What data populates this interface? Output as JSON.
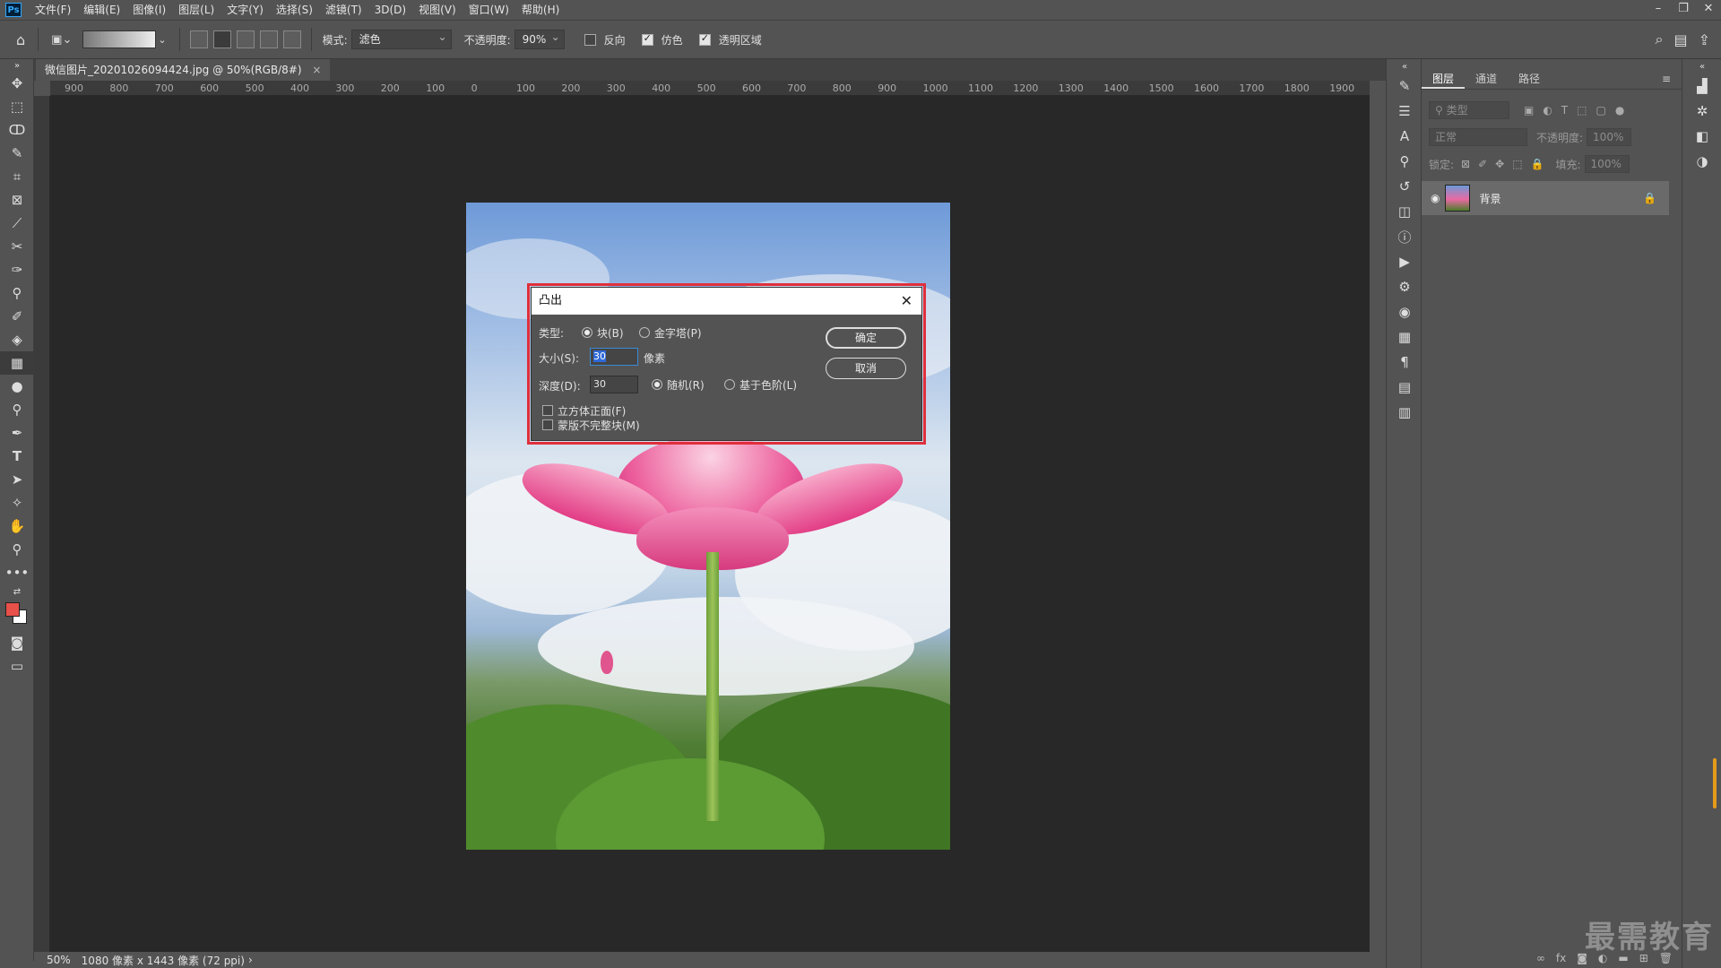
{
  "menubar": {
    "logo": "Ps",
    "items": [
      "文件(F)",
      "编辑(E)",
      "图像(I)",
      "图层(L)",
      "文字(Y)",
      "选择(S)",
      "滤镜(T)",
      "3D(D)",
      "视图(V)",
      "窗口(W)",
      "帮助(H)"
    ]
  },
  "options": {
    "mode_label": "模式:",
    "mode_value": "滤色",
    "opacity_label": "不透明度:",
    "opacity_value": "90%",
    "reverse_label": "反向",
    "dither_label": "仿色",
    "transparency_label": "透明区域"
  },
  "document": {
    "tab_title": "微信图片_20201026094424.jpg @ 50%(RGB/8#)",
    "tab_close": "×"
  },
  "ruler": {
    "top_ticks": [
      "900",
      "800",
      "700",
      "600",
      "500",
      "400",
      "300",
      "200",
      "100",
      "0",
      "100",
      "200",
      "300",
      "400",
      "500",
      "600",
      "700",
      "800",
      "900",
      "1000",
      "1100",
      "1200",
      "1300",
      "1400",
      "1500",
      "1600",
      "1700",
      "1800",
      "1900"
    ]
  },
  "status": {
    "zoom": "50%",
    "info": "1080 像素 x 1443 像素 (72 ppi)",
    "arrow": "›"
  },
  "dialog": {
    "title": "凸出",
    "close": "✕",
    "type_label": "类型:",
    "type_block": "块(B)",
    "type_pyramid": "金字塔(P)",
    "size_label": "大小(S):",
    "size_value": "30",
    "size_unit": "像素",
    "depth_label": "深度(D):",
    "depth_value": "30",
    "depth_random": "随机(R)",
    "depth_level": "基于色阶(L)",
    "solid_front": "立方体正面(F)",
    "mask_incomplete": "蒙版不完整块(M)",
    "ok": "确定",
    "cancel": "取消"
  },
  "layers_panel": {
    "tabs": [
      "图层",
      "通道",
      "路径"
    ],
    "filter_placeholder": "类型",
    "blend_mode": "正常",
    "opacity_label": "不透明度:",
    "opacity_value": "100%",
    "lock_label": "锁定:",
    "fill_label": "填充:",
    "fill_value": "100%",
    "layer_name": "背景"
  },
  "watermark": "最需教育",
  "colors": {
    "foreground": "#e8504a",
    "background": "#ffffff",
    "highlight": "#e02f3c"
  }
}
